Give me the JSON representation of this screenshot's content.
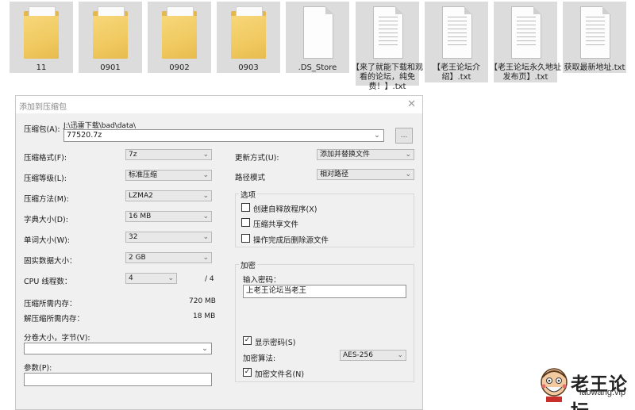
{
  "files": [
    {
      "name": "11",
      "kind": "folder"
    },
    {
      "name": "0901",
      "kind": "folder"
    },
    {
      "name": "0902",
      "kind": "folder"
    },
    {
      "name": "0903",
      "kind": "folder"
    },
    {
      "name": ".DS_Store",
      "kind": "blank"
    },
    {
      "name": "【来了就能下载和观看的论坛，纯免费！】.txt",
      "kind": "txt"
    },
    {
      "name": "【老王论坛介绍】.txt",
      "kind": "txt"
    },
    {
      "name": "【老王论坛永久地址发布页】.txt",
      "kind": "txt"
    },
    {
      "name": "获取最新地址.txt",
      "kind": "txt"
    }
  ],
  "dialog": {
    "title": "添加到压缩包",
    "close_glyph": "✕",
    "archive_label": "压缩包(A):",
    "archive_path": "J:\\迅雷下载\\bad\\data\\",
    "archive_name": "77520.7z",
    "browse_label": "...",
    "format_label": "压缩格式(F):",
    "format_value": "7z",
    "level_label": "压缩等级(L):",
    "level_value": "标准压缩",
    "method_label": "压缩方法(M):",
    "method_value": "LZMA2",
    "dict_label": "字典大小(D):",
    "dict_value": "16 MB",
    "word_label": "单词大小(W):",
    "word_value": "32",
    "solid_label": "固实数据大小：",
    "solid_value": "2 GB",
    "threads_label": "CPU 线程数：",
    "threads_value": "4",
    "threads_max": "/ 4",
    "mem_compress_label": "压缩所需内存：",
    "mem_compress_value": "720 MB",
    "mem_decompress_label": "解压缩所需内存：",
    "mem_decompress_value": "18 MB",
    "split_label": "分卷大小，字节(V):",
    "split_value": "",
    "params_label": "参数(P):",
    "params_value": "",
    "update_label": "更新方式(U):",
    "update_value": "添加并替换文件",
    "path_label": "路径模式",
    "path_value": "相对路径",
    "options_title": "选项",
    "options": [
      {
        "label": "创建自释放程序(X)",
        "checked": false
      },
      {
        "label": "压缩共享文件",
        "checked": false
      },
      {
        "label": "操作完成后删除源文件",
        "checked": false
      }
    ],
    "encrypt_title": "加密",
    "password_label": "输入密码：",
    "password_value": "上老王论坛当老王",
    "show_password_label": "显示密码(S)",
    "show_password_checked": true,
    "enc_method_label": "加密算法:",
    "enc_method_value": "AES-256",
    "encrypt_names_label": "加密文件名(N)",
    "encrypt_names_checked": true,
    "check_glyph": "✓",
    "caret_glyph": "⌄"
  },
  "watermark": {
    "brand": "老王论坛",
    "url": "laowang.vip"
  }
}
